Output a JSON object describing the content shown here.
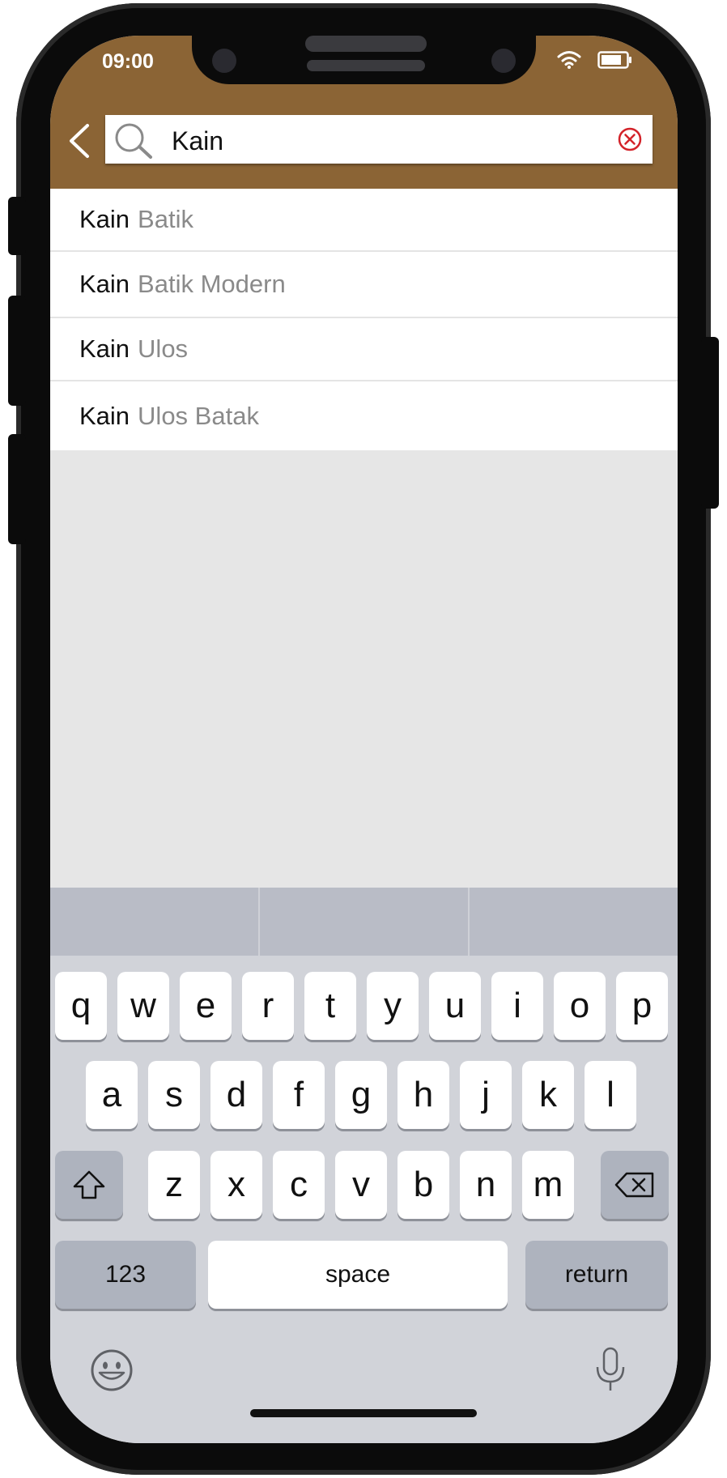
{
  "status_bar": {
    "time": "09:00",
    "icons": [
      "wifi-icon",
      "battery-icon"
    ]
  },
  "search": {
    "query": "Kain",
    "back_icon": "chevron-left-icon",
    "search_icon": "search-icon",
    "clear_icon": "clear-circle-icon"
  },
  "suggestions": [
    {
      "query": "Kain",
      "rest": "Batik"
    },
    {
      "query": "Kain",
      "rest": "Batik Modern"
    },
    {
      "query": "Kain",
      "rest": "Ulos"
    },
    {
      "query": "Kain",
      "rest": "Ulos Batak"
    }
  ],
  "keyboard": {
    "row1": [
      "q",
      "w",
      "e",
      "r",
      "t",
      "y",
      "u",
      "i",
      "o",
      "p"
    ],
    "row2": [
      "a",
      "s",
      "d",
      "f",
      "g",
      "h",
      "j",
      "k",
      "l"
    ],
    "row3": [
      "z",
      "x",
      "c",
      "v",
      "b",
      "n",
      "m"
    ],
    "numbers_label": "123",
    "space_label": "space",
    "return_label": "return",
    "shift_icon": "shift-icon",
    "backspace_icon": "backspace-icon",
    "emoji_icon": "emoji-icon",
    "mic_icon": "microphone-icon"
  },
  "colors": {
    "header": "#8b6435",
    "clear_icon": "#d3232a"
  }
}
